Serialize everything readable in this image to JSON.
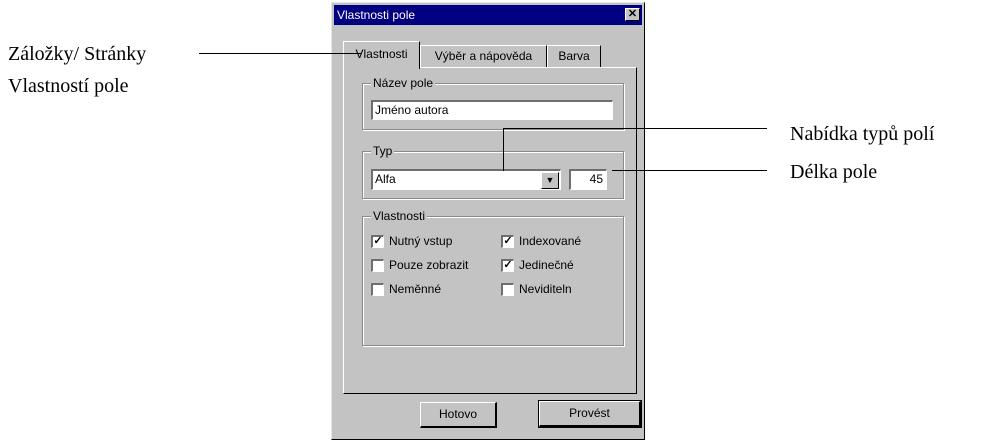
{
  "dialog": {
    "title": "Vlastnosti pole",
    "close_glyph": "✕",
    "tabs": [
      "Vlastnosti",
      "Výběr a nápověda",
      "Barva"
    ],
    "field_name": {
      "label": "Název pole",
      "value": "Jméno autora"
    },
    "type": {
      "label": "Typ",
      "selected": "Alfa",
      "length": "45",
      "dropdown_glyph": "▼"
    },
    "properties": {
      "label": "Vlastnosti",
      "items": [
        {
          "label": "Nutný vstup",
          "checked": true
        },
        {
          "label": "Indexované",
          "checked": true
        },
        {
          "label": "Pouze zobrazit",
          "checked": false
        },
        {
          "label": "Jedinečné",
          "checked": true
        },
        {
          "label": "Neměnné",
          "checked": false
        },
        {
          "label": "Neviditeln",
          "checked": false
        }
      ]
    },
    "buttons": {
      "done": "Hotovo",
      "execute": "Provést"
    }
  },
  "callouts": {
    "tabs_line1": "Záložky/ Stránky",
    "tabs_line2": "Vlastností pole",
    "field_types": "Nabídka typů polí",
    "field_length": "Délka pole"
  }
}
